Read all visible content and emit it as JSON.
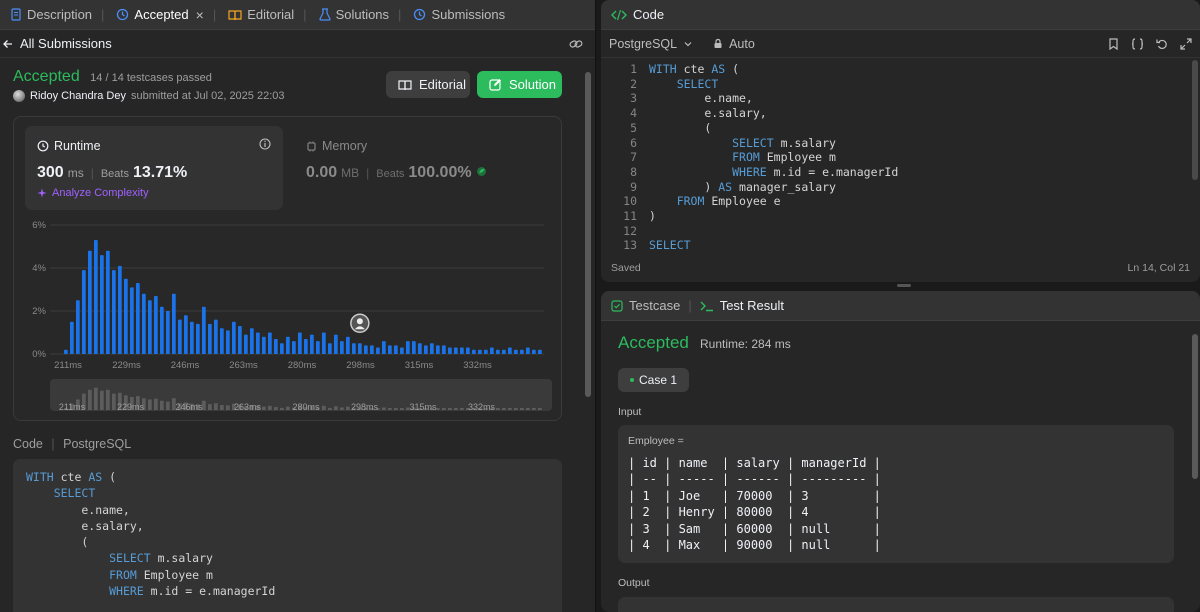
{
  "left_tabs": [
    {
      "label": "Description",
      "icon": "document-icon"
    },
    {
      "label": "Accepted",
      "icon": "history-icon",
      "close": "×"
    },
    {
      "label": "Editorial",
      "icon": "book-icon"
    },
    {
      "label": "Solutions",
      "icon": "flask-icon"
    },
    {
      "label": "Submissions",
      "icon": "history-icon"
    }
  ],
  "subbar": {
    "back_label": "All Submissions"
  },
  "submission": {
    "status": "Accepted",
    "passed": "14 / 14 testcases passed",
    "author": "Ridoy Chandra Dey",
    "submitted": "submitted at Jul 02, 2025 22:03",
    "editorial_label": "Editorial",
    "solution_label": "Solution"
  },
  "runtime": {
    "title": "Runtime",
    "value": "300",
    "unit": "ms",
    "beats_label": "Beats",
    "beats": "13.71%",
    "analyze": "Analyze Complexity"
  },
  "memory": {
    "title": "Memory",
    "value": "0.00",
    "unit": "MB",
    "beats_label": "Beats",
    "beats": "100.00%"
  },
  "chart_data": {
    "type": "bar",
    "y_ticks": [
      "6%",
      "4%",
      "2%",
      "0%"
    ],
    "ylim": [
      0,
      6
    ],
    "x_ticks": [
      "211ms",
      "229ms",
      "246ms",
      "263ms",
      "280ms",
      "298ms",
      "315ms",
      "332ms"
    ],
    "values": [
      0.2,
      1.5,
      2.5,
      3.9,
      4.8,
      5.3,
      4.6,
      4.8,
      3.9,
      4.1,
      3.5,
      3.1,
      3.3,
      2.8,
      2.5,
      2.7,
      2.2,
      2.0,
      2.8,
      1.6,
      1.8,
      1.5,
      1.4,
      2.2,
      1.4,
      1.6,
      1.2,
      1.1,
      1.5,
      1.3,
      0.9,
      1.2,
      1.0,
      0.8,
      1.0,
      0.7,
      0.5,
      0.8,
      0.6,
      1.0,
      0.7,
      0.9,
      0.6,
      1.0,
      0.5,
      0.9,
      0.6,
      0.8,
      0.5,
      0.5,
      0.4,
      0.4,
      0.3,
      0.6,
      0.4,
      0.4,
      0.3,
      0.6,
      0.6,
      0.5,
      0.4,
      0.5,
      0.4,
      0.4,
      0.3,
      0.3,
      0.3,
      0.3,
      0.2,
      0.2,
      0.2,
      0.3,
      0.2,
      0.2,
      0.3,
      0.2,
      0.2,
      0.3,
      0.2,
      0.2
    ],
    "highlight_index": 49,
    "bar_color": "#1a73e8",
    "grid": true
  },
  "mini_x_ticks": [
    "211ms",
    "229ms",
    "246ms",
    "263ms",
    "280ms",
    "298ms",
    "315ms",
    "332ms"
  ],
  "code_section": {
    "label": "Code",
    "lang": "PostgreSQL"
  },
  "submitted_code": [
    "WITH cte AS (",
    "    SELECT",
    "        e.name,",
    "        e.salary,",
    "        (",
    "            SELECT m.salary",
    "            FROM Employee m",
    "            WHERE m.id = e.managerId"
  ],
  "code_panel": {
    "title": "Code",
    "language": "PostgreSQL",
    "auto": "Auto",
    "saved": "Saved",
    "cursor": "Ln 14, Col 21",
    "lines": [
      "WITH cte AS (",
      "    SELECT",
      "        e.name,",
      "        e.salary,",
      "        (",
      "            SELECT m.salary",
      "            FROM Employee m",
      "            WHERE m.id = e.managerId",
      "        ) AS manager_salary",
      "    FROM Employee e",
      ")",
      "",
      "SELECT"
    ],
    "line_numbers": [
      "1",
      "2",
      "3",
      "4",
      "5",
      "6",
      "7",
      "8",
      "9",
      "10",
      "11",
      "12",
      "13"
    ]
  },
  "result_panel": {
    "testcase_tab": "Testcase",
    "result_tab": "Test Result",
    "status": "Accepted",
    "runtime": "Runtime: 284 ms",
    "case_label": "Case 1",
    "input_label": "Input",
    "var_label": "Employee =",
    "table_text": "| id | name  | salary | managerId |\n| -- | ----- | ------ | --------- |\n| 1  | Joe   | 70000  | 3         |\n| 2  | Henry | 80000  | 4         |\n| 3  | Sam   | 60000  | null      |\n| 4  | Max   | 90000  | null      |",
    "output_label": "Output"
  }
}
